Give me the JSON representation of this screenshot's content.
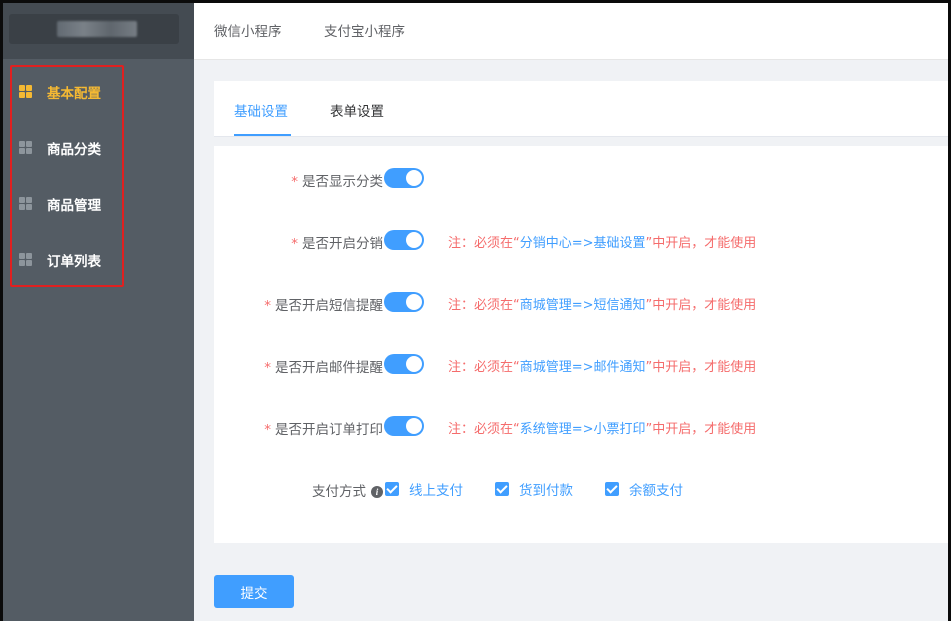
{
  "top_tabs": [
    "微信小程序",
    "支付宝小程序"
  ],
  "sidebar": {
    "items": [
      {
        "label": "基本配置",
        "active": true
      },
      {
        "label": "商品分类",
        "active": false
      },
      {
        "label": "商品管理",
        "active": false
      },
      {
        "label": "订单列表",
        "active": false
      }
    ]
  },
  "sub_tabs": [
    "基础设置",
    "表单设置"
  ],
  "form": {
    "rows": [
      {
        "label": "是否显示分类",
        "required": true,
        "switch_on": true,
        "note_prefix": "",
        "note_path": "",
        "note_suffix": ""
      },
      {
        "label": "是否开启分销",
        "required": true,
        "switch_on": true,
        "note_prefix": "注：必须在“",
        "note_path": "分销中心=>基础设置",
        "note_suffix": "”中开启，才能使用"
      },
      {
        "label": "是否开启短信提醒",
        "required": true,
        "switch_on": true,
        "note_prefix": "注：必须在“",
        "note_path": "商城管理=>短信通知",
        "note_suffix": "”中开启，才能使用"
      },
      {
        "label": "是否开启邮件提醒",
        "required": true,
        "switch_on": true,
        "note_prefix": "注：必须在“",
        "note_path": "商城管理=>邮件通知",
        "note_suffix": "”中开启，才能使用"
      },
      {
        "label": "是否开启订单打印",
        "required": true,
        "switch_on": true,
        "note_prefix": "注：必须在“",
        "note_path": "系统管理=>小票打印",
        "note_suffix": "”中开启，才能使用"
      }
    ],
    "required_mark": "*",
    "payment": {
      "label": "支付方式",
      "info_icon": "i",
      "options": [
        {
          "label": "线上支付",
          "checked": true
        },
        {
          "label": "货到付款",
          "checked": true
        },
        {
          "label": "余额支付",
          "checked": true
        }
      ]
    }
  },
  "submit_label": "提交",
  "colors": {
    "primary": "#409eff",
    "active_menu": "#f5b933",
    "danger": "#f56c6c",
    "sidebar": "#545c64"
  }
}
